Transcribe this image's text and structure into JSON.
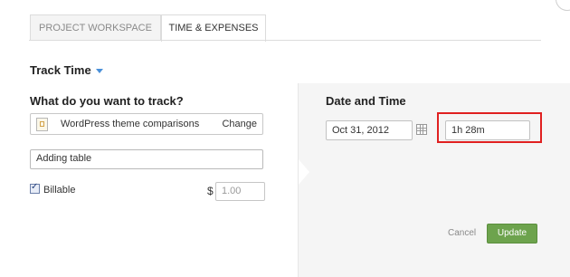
{
  "tabs": [
    {
      "label": "PROJECT WORKSPACE",
      "active": false
    },
    {
      "label": "TIME & EXPENSES",
      "active": true
    }
  ],
  "track": {
    "title": "Track Time"
  },
  "left": {
    "question": "What do you want to track?",
    "project_name": "WordPress theme comparisons",
    "change_label": "Change",
    "description_value": "Adding table",
    "billable_label": "Billable",
    "billable_checked": true,
    "currency": "$",
    "rate_placeholder": "1.00"
  },
  "right": {
    "title": "Date and Time",
    "date_value": "Oct 31, 2012",
    "time_value": "1h 28m"
  },
  "actions": {
    "cancel_label": "Cancel",
    "update_label": "Update"
  },
  "colors": {
    "accent": "#4a90d9",
    "update_button": "#6da34d",
    "highlight": "#e02020"
  }
}
